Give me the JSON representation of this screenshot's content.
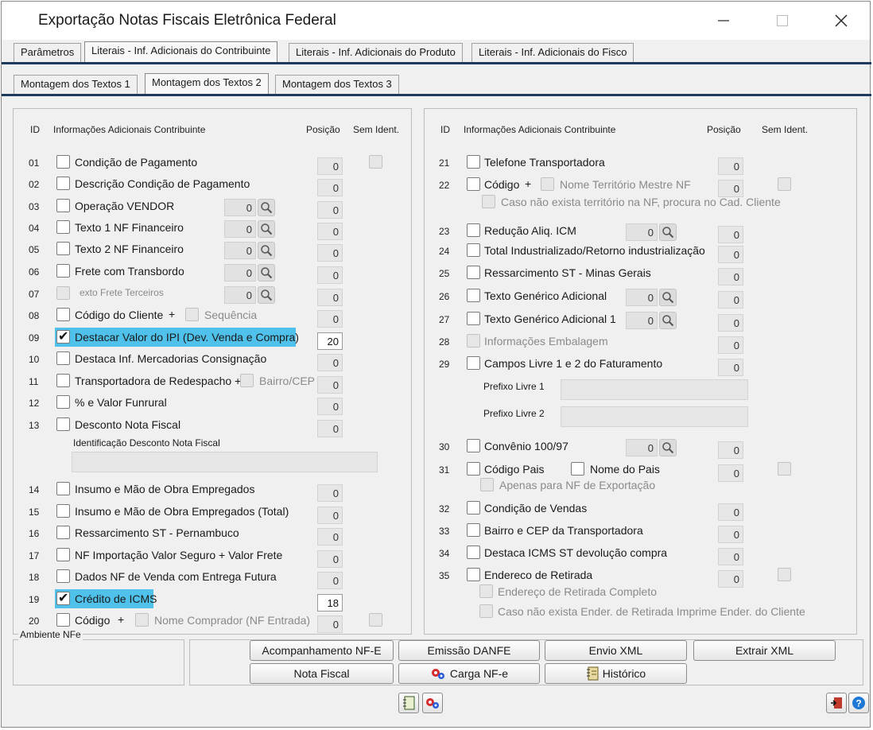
{
  "window": {
    "title": "Exportação Notas Fiscais Eletrônica Federal"
  },
  "tabs_main": [
    "Parâmetros",
    "Literais - Inf. Adicionais do Contribuinte",
    "Literais - Inf. Adicionais do Produto",
    "Literais - Inf. Adicionais do Fisco"
  ],
  "tabs_sub": [
    "Montagem dos Textos 1",
    "Montagem dos Textos 2",
    "Montagem dos Textos 3"
  ],
  "headers": {
    "id": "ID",
    "info": "Informações Adicionais Contribuinte",
    "posicao": "Posição",
    "sem_ident": "Sem Ident."
  },
  "left": {
    "rows": [
      {
        "id": "01",
        "label": "Condição de Pagamento",
        "pos": "0"
      },
      {
        "id": "02",
        "label": "Descrição Condição de Pagamento",
        "pos": "0"
      },
      {
        "id": "03",
        "label": "Operação VENDOR",
        "search": "0",
        "pos": "0"
      },
      {
        "id": "04",
        "label": "Texto 1 NF Financeiro",
        "search": "0",
        "pos": "0"
      },
      {
        "id": "05",
        "label": "Texto 2 NF Financeiro",
        "search": "0",
        "pos": "0"
      },
      {
        "id": "06",
        "label": "Frete com Transbordo",
        "search": "0",
        "pos": "0"
      },
      {
        "id": "07",
        "label": "exto Frete Terceiros",
        "search": "0",
        "pos": "0"
      },
      {
        "id": "08",
        "label": "Código do Cliente",
        "plus": "+",
        "sub": "Sequência",
        "pos": "0"
      },
      {
        "id": "09",
        "label": "Destacar Valor do IPI (Dev. Venda e Compra)",
        "pos": "20",
        "checked": true
      },
      {
        "id": "10",
        "label": "Destaca Inf. Mercadorias Consignação",
        "pos": "0"
      },
      {
        "id": "11",
        "label": "Transportadora de Redespacho +",
        "sub": "Bairro/CEP",
        "pos": "0"
      },
      {
        "id": "12",
        "label": "% e Valor Funrural",
        "pos": "0"
      },
      {
        "id": "13",
        "label": "Desconto Nota Fiscal",
        "pos": "0"
      },
      {
        "id": "14",
        "label": "Insumo e Mão de Obra Empregados",
        "pos": "0"
      },
      {
        "id": "15",
        "label": "Insumo e Mão de Obra Empregados (Total)",
        "pos": "0"
      },
      {
        "id": "16",
        "label": "Ressarcimento ST - Pernambuco",
        "pos": "0"
      },
      {
        "id": "17",
        "label": "NF Importação Valor Seguro + Valor Frete",
        "pos": "0"
      },
      {
        "id": "18",
        "label": "Dados NF de Venda com Entrega Futura",
        "pos": "0"
      },
      {
        "id": "19",
        "label": "Crédito de ICMS",
        "pos": "18",
        "checked": true
      },
      {
        "id": "20",
        "label": "Código",
        "plus": "+",
        "sub": "Nome Comprador (NF Entrada)",
        "pos": "0"
      }
    ],
    "desconto_label": "Identificação Desconto Nota Fiscal"
  },
  "right": {
    "rows": [
      {
        "id": "21",
        "label": "Telefone Transportadora",
        "pos": "0"
      },
      {
        "id": "22",
        "label": "Código",
        "plus": "+",
        "sub": "Nome Território Mestre NF",
        "pos": "0",
        "extra": "Caso não exista território na NF, procura no Cad. Cliente"
      },
      {
        "id": "23",
        "label": "Redução Aliq. ICM",
        "search": "0",
        "pos": "0"
      },
      {
        "id": "24",
        "label": "Total Industrializado/Retorno industrialização",
        "pos": "0"
      },
      {
        "id": "25",
        "label": "Ressarcimento ST - Minas Gerais",
        "pos": "0"
      },
      {
        "id": "26",
        "label": "Texto Genérico Adicional",
        "search": "0",
        "pos": "0"
      },
      {
        "id": "27",
        "label": "Texto Genérico Adicional 1",
        "search": "0",
        "pos": "0"
      },
      {
        "id": "28",
        "label": "Informações Embalagem",
        "pos": "0"
      },
      {
        "id": "29",
        "label": "Campos Livre 1 e 2 do Faturamento",
        "pos": "0"
      },
      {
        "id": "30",
        "label": "Convênio 100/97",
        "search": "0",
        "pos": "0"
      },
      {
        "id": "31",
        "label": "Código Pais",
        "sub": "Nome do Pais",
        "pos": "0",
        "extra": "Apenas para NF de Exportação"
      },
      {
        "id": "32",
        "label": "Condição de Vendas",
        "pos": "0"
      },
      {
        "id": "33",
        "label": "Bairro e CEP da Transportadora",
        "pos": "0"
      },
      {
        "id": "34",
        "label": "Destaca ICMS ST devolução compra",
        "pos": "0"
      },
      {
        "id": "35",
        "label": "Endereco de Retirada",
        "pos": "0",
        "extra": "Endereço de Retirada Completo",
        "extra2": "Caso não exista Ender. de Retirada Imprime Ender. do Cliente"
      }
    ],
    "prefixo1": "Prefixo Livre 1",
    "prefixo2": "Prefixo Livre 2"
  },
  "ambiente": "Ambiente NFe",
  "buttons": {
    "acompanhamento": "Acompanhamento NF-E",
    "emissao": "Emissão DANFE",
    "envio": "Envio XML",
    "extrair": "Extrair XML",
    "nota": "Nota Fiscal",
    "carga": "Carga NF-e",
    "historico": "Histórico"
  },
  "colors": {
    "highlight": "#4fc1ea",
    "tab_line": "#1f3b5c",
    "help": "#1e78d6",
    "exit": "#c0392b"
  }
}
